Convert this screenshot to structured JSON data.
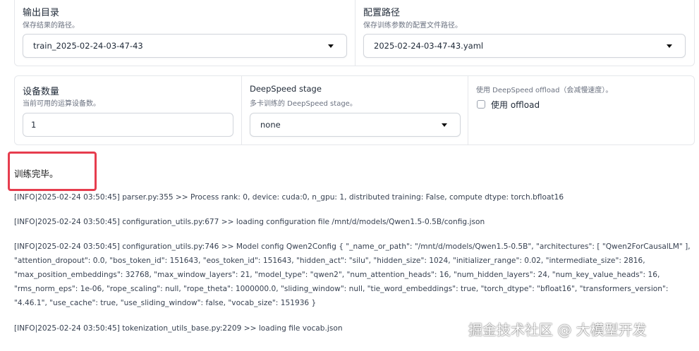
{
  "row1": {
    "output_dir": {
      "label": "输出目录",
      "info": "保存结果的路径。",
      "value": "train_2025-02-24-03-47-43"
    },
    "config_path": {
      "label": "配置路径",
      "info": "保存训练参数的配置文件路径。",
      "value": "2025-02-24-03-47-43.yaml"
    }
  },
  "row2": {
    "device_count": {
      "label": "设备数量",
      "info": "当前可用的运算设备数。",
      "value": "1"
    },
    "ds_stage": {
      "label": "DeepSpeed stage",
      "info": "多卡训练的 DeepSpeed stage。",
      "value": "none"
    },
    "ds_offload": {
      "info": "使用 DeepSpeed offload（会减慢速度）。",
      "checkbox_label": "使用 offload",
      "checked": false
    }
  },
  "status": {
    "text": "训练完毕。"
  },
  "log": {
    "lines": [
      "[INFO|2025-02-24 03:50:45] parser.py:355 >> Process rank: 0, device: cuda:0, n_gpu: 1, distributed training: False, compute dtype: torch.bfloat16",
      "[INFO|2025-02-24 03:50:45] configuration_utils.py:677 >> loading configuration file /mnt/d/models/Qwen1.5-0.5B/config.json",
      "[INFO|2025-02-24 03:50:45] configuration_utils.py:746 >> Model config Qwen2Config { \"_name_or_path\": \"/mnt/d/models/Qwen1.5-0.5B\", \"architectures\": [ \"Qwen2ForCausalLM\" ],",
      "\"attention_dropout\": 0.0, \"bos_token_id\": 151643, \"eos_token_id\": 151643, \"hidden_act\": \"silu\", \"hidden_size\": 1024, \"initializer_range\": 0.02, \"intermediate_size\": 2816,",
      "\"max_position_embeddings\": 32768, \"max_window_layers\": 21, \"model_type\": \"qwen2\", \"num_attention_heads\": 16, \"num_hidden_layers\": 24, \"num_key_value_heads\": 16,",
      "\"rms_norm_eps\": 1e-06, \"rope_scaling\": null, \"rope_theta\": 1000000.0, \"sliding_window\": null, \"tie_word_embeddings\": true, \"torch_dtype\": \"bfloat16\", \"transformers_version\":",
      "\"4.46.1\", \"use_cache\": true, \"use_sliding_window\": false, \"vocab_size\": 151936 }",
      "[INFO|2025-02-24 03:50:45] tokenization_utils_base.py:2209 >> loading file vocab.json"
    ]
  },
  "watermark": "掘金技术社区 @ 大模型开发",
  "colors": {
    "highlight": "#e63d4e",
    "border": "#e5e7eb"
  }
}
